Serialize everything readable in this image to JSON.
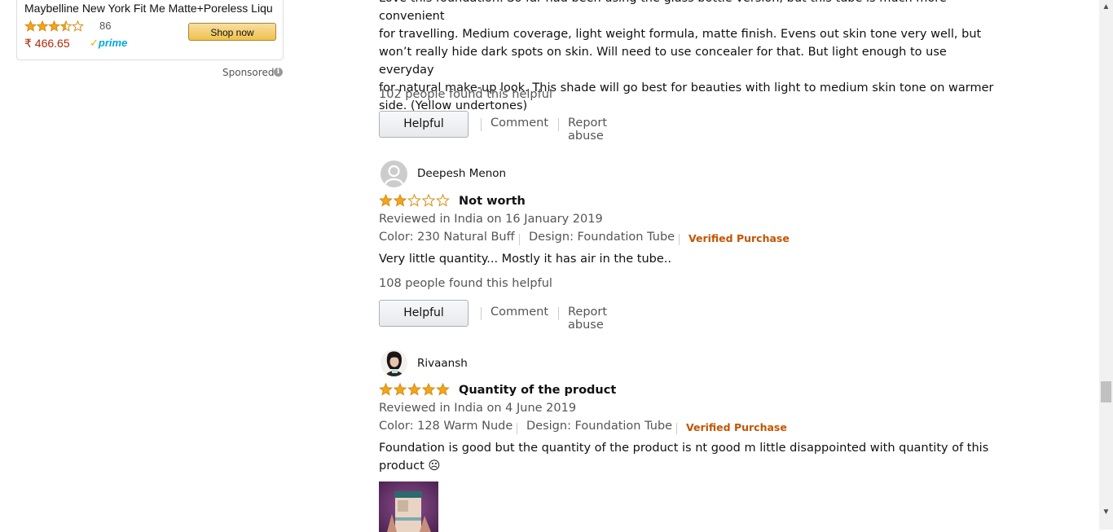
{
  "ad": {
    "title": "Maybelline New York Fit Me Matte+Poreless Liqu",
    "rating": 3.5,
    "rating_count": "86",
    "price": "₹ 466.65",
    "prime_label": "prime",
    "button_label": "Shop now",
    "sponsored_label": "Sponsored"
  },
  "review0": {
    "body_lines": [
      "Love this foundation. So far had been using the glass bottle version, but this tube is much more convenient",
      "for travelling. Medium coverage, light weight formula, matte finish. Evens out skin tone very well, but",
      "won’t really hide dark spots on skin. Will need to use concealer for that. But light enough to use everyday",
      "for natural make-up look. This shade will go best for beauties with light to medium skin tone on warmer",
      "side. (Yellow undertones)"
    ],
    "helpful_text": "102 people found this helpful"
  },
  "review1": {
    "reviewer": "Deepesh Menon",
    "rating": 2,
    "title": "Not worth",
    "date": "Reviewed in India on 16 January 2019",
    "color": "Color: 230 Natural Buff",
    "design": "Design: Foundation Tube",
    "verified": "Verified Purchase",
    "body": "Very little quantity... Mostly it has air in the tube..",
    "helpful_text": "108 people found this helpful"
  },
  "review2": {
    "reviewer": "Rivaansh",
    "rating": 5,
    "title": "Quantity of the product",
    "date": "Reviewed in India on 4 June 2019",
    "color": "Color: 128 Warm Nude",
    "design": "Design: Foundation Tube",
    "verified": "Verified Purchase",
    "body_line1": "Foundation is good but the quantity of the product is nt good m little disappointed with quantity of this",
    "body_line2": "product ☹"
  },
  "actions": {
    "helpful": "Helpful",
    "comment": "Comment",
    "report": "Report abuse"
  },
  "colors": {
    "star": "#f4a41c",
    "verified": "#c45500",
    "price": "#b12704"
  }
}
